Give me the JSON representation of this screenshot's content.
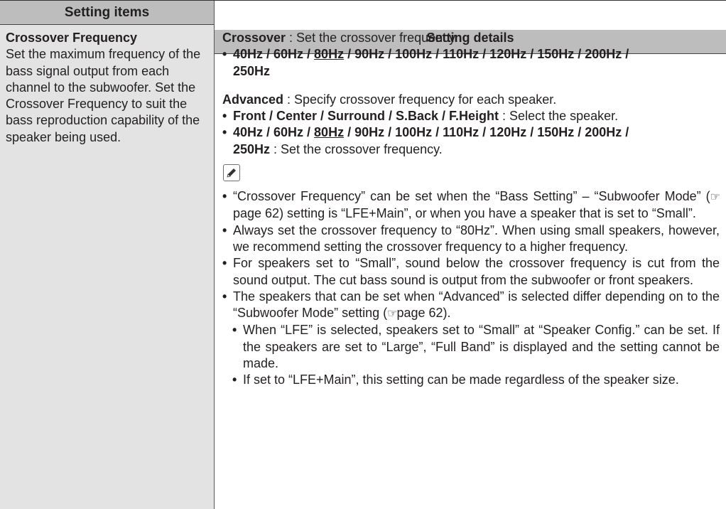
{
  "headers": {
    "items": "Setting items",
    "details": "Setting details"
  },
  "item": {
    "title": "Crossover Frequency",
    "description": "Set the maximum frequency of the bass signal output from each channel to the subwoofer. Set the Crossover Frequency to suit the bass reproduction capability of the speaker being used."
  },
  "details": {
    "crossover": {
      "label": "Crossover",
      "desc": " : Set the crossover frequency.",
      "freqs_a": "40Hz / 60Hz / ",
      "freqs_default": "80Hz",
      "freqs_b": " / 90Hz / 100Hz / 110Hz / 120Hz / 150Hz / 200Hz /",
      "freqs_c": "250Hz"
    },
    "advanced": {
      "label": "Advanced",
      "desc": " : Specify crossover frequency for each speaker.",
      "speakers": "Front / Center / Surround / S.Back / F.Height",
      "speakers_desc": " : Select the speaker.",
      "freqs_a": "40Hz / 60Hz / ",
      "freqs_default": "80Hz",
      "freqs_b": " / 90Hz / 100Hz / 110Hz / 120Hz / 150Hz / 200Hz /",
      "freqs_c": "250Hz",
      "freqs_desc": " : Set the crossover frequency."
    },
    "memo_icon": "pencil-icon",
    "page_icon": "☞",
    "notes": {
      "n1a": "“Crossover Frequency” can be set when the “Bass Setting” – “Subwoofer Mode” (",
      "n1b": "page 62) setting is “LFE+Main”, or when you have a speaker that is set to “Small”.",
      "n2": "Always set the crossover frequency to “80Hz”. When using small speakers, however, we recommend setting the crossover frequency to a higher frequency.",
      "n3": "For speakers set to “Small”, sound below the crossover frequency is cut from the sound output. The cut bass sound is output from the subwoofer or front speakers.",
      "n4a": "The speakers that can be set when “Advanced” is selected differ depending on to the “Subwoofer Mode” setting (",
      "n4b": "page 62).",
      "s1": "When “LFE” is selected, speakers set to “Small” at “Speaker Config.” can be set. If the speakers are set to “Large”, “Full Band” is displayed and the setting cannot be made.",
      "s2": "If set to “LFE+Main”, this setting can be made regardless of the speaker size."
    }
  }
}
